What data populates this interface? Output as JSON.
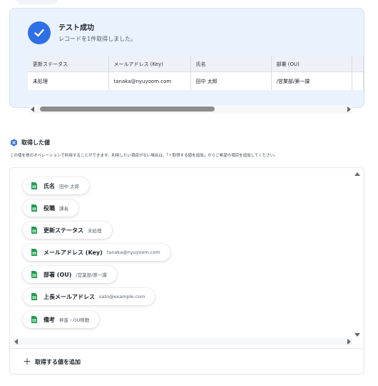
{
  "test_result": {
    "title": "テスト成功",
    "message": "レコードを1件取得しました。",
    "table": {
      "headers": [
        "更新ステータス",
        "メールアドレス (Key)",
        "氏名",
        "部署 (OU)"
      ],
      "rows": [
        [
          "未処理",
          "tanaka@nyuyoom.com",
          "田中 太郎",
          "/営業部/第一課"
        ]
      ]
    }
  },
  "retrieved": {
    "heading": "取得した値",
    "description": "この値を他のオペレーションで利用することができます。利用したい項目がない場合は、「＋取得する値を追加」からご希望の項目を追加してください。",
    "items": [
      {
        "label": "氏名",
        "value": "田中 太郎"
      },
      {
        "label": "役職",
        "value": "課長"
      },
      {
        "label": "更新ステータス",
        "value": "未処理"
      },
      {
        "label": "メールアドレス (Key)",
        "value": "tanaka@nyuyoom.com"
      },
      {
        "label": "部署 (OU)",
        "value": "/営業部/第一課"
      },
      {
        "label": "上長メールアドレス",
        "value": "sato@example.com"
      },
      {
        "label": "備考",
        "value": "昇進・OU移動"
      }
    ],
    "add_label": "取得する値を追加"
  },
  "colors": {
    "accent": "#2f6fe8",
    "panel_bg": "#eaf2fd",
    "sheet_green": "#1e9e4f"
  },
  "icons": {
    "success": "check-circle-icon",
    "section": "hexagon-x-icon",
    "item": "spreadsheet-icon",
    "add": "plus-icon"
  }
}
